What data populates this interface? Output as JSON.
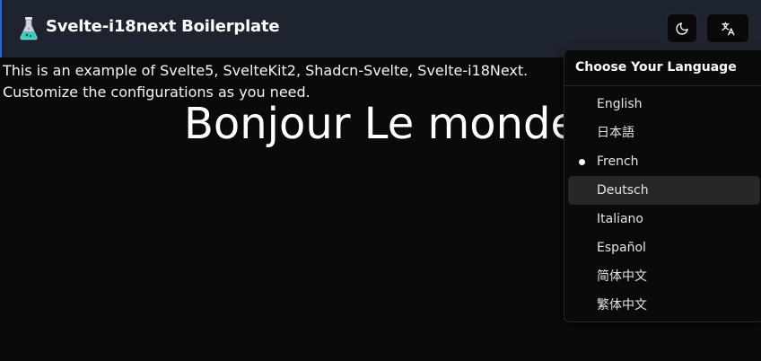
{
  "header": {
    "title": "Svelte-i18next Boilerplate",
    "logo_icon": "flask-icon",
    "theme_icon": "moon-icon",
    "language_icon": "translate-icon",
    "accent": "#2563eb"
  },
  "main": {
    "intro_lines": [
      "This is an example of Svelte5, SvelteKit2, Shadcn-Svelte, Svelte-i18Next.",
      "Customize the configurations as you need."
    ],
    "greeting": "Bonjour Le monde"
  },
  "language_menu": {
    "label": "Choose Your Language",
    "selected": "French",
    "highlighted": "Deutsch",
    "items": [
      {
        "label": "English"
      },
      {
        "label": "日本語"
      },
      {
        "label": "French"
      },
      {
        "label": "Deutsch"
      },
      {
        "label": "Italiano"
      },
      {
        "label": "Español"
      },
      {
        "label": "简体中文"
      },
      {
        "label": "繁体中文"
      }
    ]
  }
}
